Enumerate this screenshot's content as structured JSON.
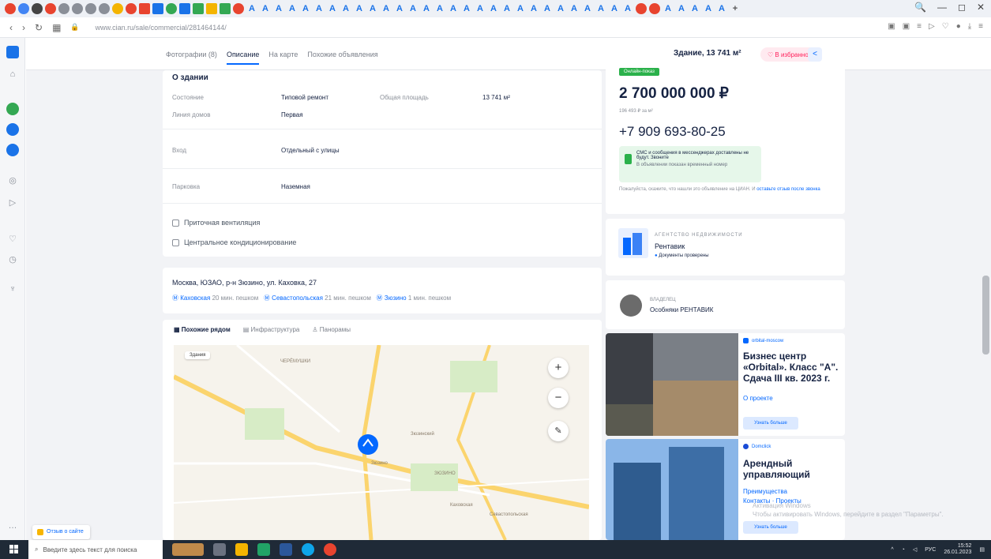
{
  "browser": {
    "url": "www.cian.ru/sale/commercial/281464144/",
    "window_controls": [
      "🔍",
      "—",
      "◻",
      "✕"
    ]
  },
  "subnav": {
    "tabs": [
      "Фотографии (8)",
      "Описание",
      "На карте",
      "Похожие объявления"
    ],
    "building_area": "Здание, 13 741 м²",
    "favorite": "В избранное"
  },
  "about": {
    "title": "О здании",
    "state_label": "Состояние",
    "state_value": "Типовой ремонт",
    "line_label": "Линия домов",
    "line_value": "Первая",
    "area_label": "Общая площадь",
    "area_value": "13 741 м²",
    "entrance_label": "Вход",
    "entrance_value": "Отдельный с улицы",
    "parking_label": "Парковка",
    "parking_value": "Наземная"
  },
  "features": [
    "Приточная вентиляция",
    "Центральное кондиционирование"
  ],
  "location": {
    "address": "Москва, ЮЗАО, р-н Зюзино, ул. Каховка, 27",
    "metro": [
      {
        "name": "Каховская",
        "time": "20 мин. пешком"
      },
      {
        "name": "Севастопольская",
        "time": "21 мин. пешком"
      },
      {
        "name": "Зюзино",
        "time": "1 мин. пешком"
      }
    ]
  },
  "map": {
    "tabs": [
      "Похожие рядом",
      "Инфраструктура",
      "Панорамы"
    ],
    "zoom_in": "+",
    "zoom_out": "−",
    "labels": [
      "ЧЕРЁМУШКИ",
      "ЗЮЗИНО",
      "Зюзино",
      "Каховская",
      "Севастопольская",
      "Зюзинский"
    ],
    "chip": "Здания"
  },
  "offer": {
    "badge": "Онлайн-показ",
    "price": "2 700 000 000 ₽",
    "price_per_m2": "196 493 ₽ за м²",
    "phone": "+7 909 693-80-25",
    "sms_title": "СМС и сообщения в мессенджерах доставлены не будут. Звоните",
    "sms_sub": "В объявлении показан временный номер",
    "note": "Пожалуйста, скажите, что нашли это объявление на ЦИАН. И",
    "note_link": "оставьте отзыв после звонка"
  },
  "agency": {
    "kind": "АГЕНТСТВО НЕДВИЖИМОСТИ",
    "name": "Рентавик",
    "verified": "Документы проверены"
  },
  "owner": {
    "kind": "ВЛАДЕЛЕЦ",
    "name": "Особняки РЕНТАВИК"
  },
  "ads": [
    {
      "source": "orbital-moscow",
      "title": "Бизнес центр «Orbital». Класс \"А\". Сдача III кв. 2023 г.",
      "link": "О проекте",
      "button": "Узнать больше"
    },
    {
      "source": "Domclick",
      "title": "Арендный управляющий",
      "link": "Преимущества",
      "links2": "Контакты · Проекты",
      "button": "Узнать больше"
    }
  ],
  "windows_activate": [
    "Активация Windows",
    "Чтобы активировать Windows, перейдите в раздел \"Параметры\"."
  ],
  "feedback": "Отзыв о сайте",
  "taskbar": {
    "search_placeholder": "Введите здесь текст для поиска",
    "lang": "РУС",
    "time": "15:52",
    "date": "26.01.2023"
  },
  "colors": {
    "accent": "#0468ff",
    "online": "#2bb14b",
    "favorite": "#ff1f5a"
  }
}
